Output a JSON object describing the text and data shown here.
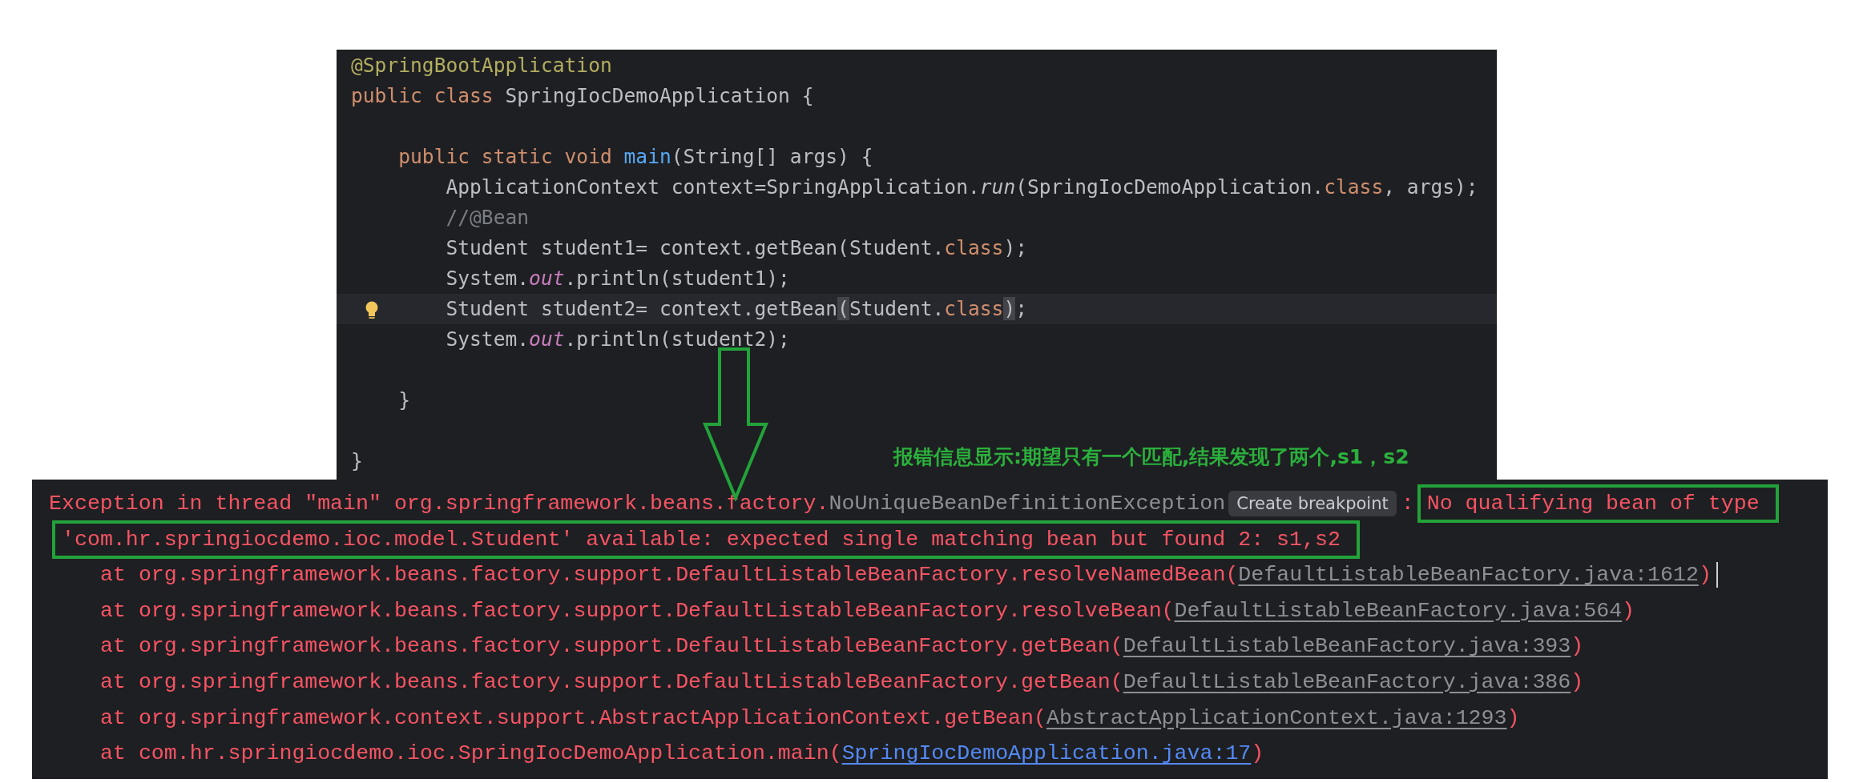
{
  "editor": {
    "lines": [
      {
        "kind": "code",
        "current": false,
        "hint": false,
        "tokens": [
          {
            "text": "@SpringBootApplication",
            "kind": "annotation"
          }
        ]
      },
      {
        "kind": "code",
        "current": false,
        "hint": false,
        "tokens": [
          {
            "text": "public class ",
            "kind": "keyword"
          },
          {
            "text": "SpringIocDemoApplication {",
            "kind": "plain"
          }
        ]
      },
      {
        "kind": "blank"
      },
      {
        "kind": "code",
        "current": false,
        "hint": false,
        "tokens": [
          {
            "text": "    public static void ",
            "kind": "keyword"
          },
          {
            "text": "main",
            "kind": "method"
          },
          {
            "text": "(String[] args) {",
            "kind": "plain"
          }
        ]
      },
      {
        "kind": "code",
        "current": false,
        "hint": false,
        "tokens": [
          {
            "text": "        ApplicationContext context=SpringApplication.",
            "kind": "plain"
          },
          {
            "text": "run",
            "kind": "static-call"
          },
          {
            "text": "(SpringIocDemoApplication.",
            "kind": "plain"
          },
          {
            "text": "class",
            "kind": "keyword"
          },
          {
            "text": ", args);",
            "kind": "plain"
          }
        ]
      },
      {
        "kind": "code",
        "current": false,
        "hint": false,
        "tokens": [
          {
            "text": "        //@Bean",
            "kind": "comment"
          }
        ]
      },
      {
        "kind": "code",
        "current": false,
        "hint": false,
        "tokens": [
          {
            "text": "        Student student1= context.getBean(Student.",
            "kind": "plain"
          },
          {
            "text": "class",
            "kind": "keyword"
          },
          {
            "text": ");",
            "kind": "plain"
          }
        ]
      },
      {
        "kind": "code",
        "current": false,
        "hint": false,
        "tokens": [
          {
            "text": "        System.",
            "kind": "plain"
          },
          {
            "text": "out",
            "kind": "field"
          },
          {
            "text": ".println(student1);",
            "kind": "plain"
          }
        ]
      },
      {
        "kind": "code",
        "current": true,
        "hint": true,
        "tokens": [
          {
            "text": "        Student student2= context.getBean",
            "kind": "plain"
          },
          {
            "text": "(",
            "kind": "match"
          },
          {
            "text": "Student.",
            "kind": "plain"
          },
          {
            "text": "class",
            "kind": "keyword"
          },
          {
            "text": ")",
            "kind": "match"
          },
          {
            "text": ";",
            "kind": "plain"
          }
        ]
      },
      {
        "kind": "code",
        "current": false,
        "hint": false,
        "tokens": [
          {
            "text": "        System.",
            "kind": "plain"
          },
          {
            "text": "out",
            "kind": "field"
          },
          {
            "text": ".println(student2);",
            "kind": "plain"
          }
        ]
      },
      {
        "kind": "blank"
      },
      {
        "kind": "code",
        "current": false,
        "hint": false,
        "tokens": [
          {
            "text": "    }",
            "kind": "plain"
          }
        ]
      },
      {
        "kind": "blank"
      },
      {
        "kind": "code",
        "current": false,
        "hint": false,
        "tokens": [
          {
            "text": "}",
            "kind": "plain"
          }
        ]
      }
    ]
  },
  "console": {
    "lines": [
      {
        "kind": "message",
        "parts": [
          {
            "text": "Exception in thread \"main\" org.springframework.beans.factory.",
            "kind": "error",
            "highlighted": false
          },
          {
            "text": "NoUniqueBeanDefinitionException",
            "kind": "class-link"
          },
          {
            "text": "Create breakpoint",
            "kind": "button"
          },
          {
            "text": ":",
            "kind": "error",
            "highlighted": false
          },
          {
            "text": "No qualifying bean of type",
            "kind": "error",
            "highlighted": true
          }
        ]
      },
      {
        "kind": "message",
        "parts": [
          {
            "text": "'com.hr.springiocdemo.ioc.model.Student' available: expected single matching bean but found 2: s1,s2",
            "kind": "error",
            "highlighted": true
          }
        ]
      },
      {
        "kind": "frame",
        "cursor": true,
        "call": "at org.springframework.beans.factory.support.DefaultListableBeanFactory.resolveNamedBean(",
        "source": "DefaultListableBeanFactory.java:1612",
        "project": false,
        "close": ")"
      },
      {
        "kind": "frame",
        "cursor": false,
        "call": "at org.springframework.beans.factory.support.DefaultListableBeanFactory.resolveBean(",
        "source": "DefaultListableBeanFactory.java:564",
        "project": false,
        "close": ")"
      },
      {
        "kind": "frame",
        "cursor": false,
        "call": "at org.springframework.beans.factory.support.DefaultListableBeanFactory.getBean(",
        "source": "DefaultListableBeanFactory.java:393",
        "project": false,
        "close": ")"
      },
      {
        "kind": "frame",
        "cursor": false,
        "call": "at org.springframework.beans.factory.support.DefaultListableBeanFactory.getBean(",
        "source": "DefaultListableBeanFactory.java:386",
        "project": false,
        "close": ")"
      },
      {
        "kind": "frame",
        "cursor": false,
        "call": "at org.springframework.context.support.AbstractApplicationContext.getBean(",
        "source": "AbstractApplicationContext.java:1293",
        "project": false,
        "close": ")"
      },
      {
        "kind": "frame",
        "cursor": false,
        "call": "at com.hr.springiocdemo.ioc.SpringIocDemoApplication.main(",
        "source": "SpringIocDemoApplication.java:17",
        "project": true,
        "close": ")"
      }
    ]
  },
  "note": {
    "text": "报错信息显示:期望只有一个匹配,结果发现了两个,s1，s2"
  }
}
